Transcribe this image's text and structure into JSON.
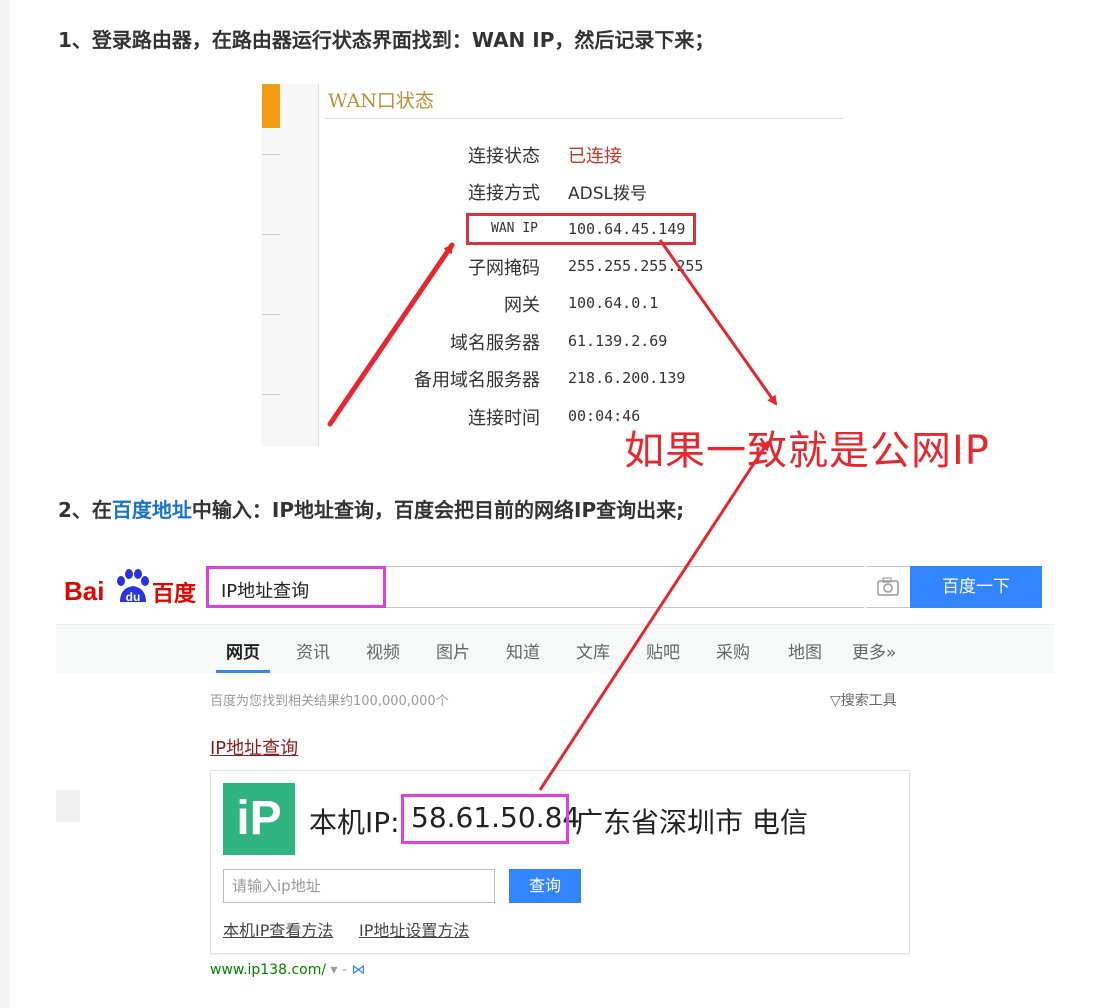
{
  "steps": {
    "step1": "1、登录路由器，在路由器运行状态界面找到：WAN IP，然后记录下来；",
    "step2_prefix": "2、在",
    "step2_link": "百度地址",
    "step2_suffix": "中输入：IP地址查询，百度会把目前的网络IP查询出来;"
  },
  "router": {
    "title": "WAN口状态",
    "rows": [
      {
        "label": "连接状态",
        "value": "已连接"
      },
      {
        "label": "连接方式",
        "value": "ADSL拨号"
      },
      {
        "label": "WAN IP",
        "value": "100.64.45.149"
      },
      {
        "label": "子网掩码",
        "value": "255.255.255.255"
      },
      {
        "label": "网关",
        "value": "100.64.0.1"
      },
      {
        "label": "域名服务器",
        "value": "61.139.2.69"
      },
      {
        "label": "备用域名服务器",
        "value": "218.6.200.139"
      },
      {
        "label": "连接时间",
        "value": "00:04:46"
      }
    ]
  },
  "annotation": "如果一致就是公网IP",
  "baidu": {
    "logo_latin": "Bai",
    "logo_paw_text": "du",
    "logo_cn": "百度",
    "query": "IP地址查询",
    "search_button": "百度一下",
    "tabs": [
      "网页",
      "资讯",
      "视频",
      "图片",
      "知道",
      "文库",
      "贴吧",
      "采购",
      "地图",
      "更多»"
    ],
    "result_count": "百度为您找到相关结果约100,000,000个",
    "search_tools": "▽搜索工具",
    "result_title": "IP地址查询",
    "ip_card": {
      "logo": "iP",
      "label": "本机IP:",
      "ip": "58.61.50.84",
      "location": "广东省深圳市 电信",
      "input_placeholder": "请输入ip地址",
      "query_button": "查询",
      "link1": "本机IP查看方法",
      "link2": "IP地址设置方法"
    },
    "url": "www.ip138.com/",
    "url_suffix": " ▾ - "
  },
  "colors": {
    "annotation_red": "#e8262e",
    "highlight_magenta": "#e040e0",
    "baidu_red": "#e10601",
    "baidu_blue": "#3385ff",
    "link_blue": "#1a73c9",
    "ip_green": "#2fb380"
  }
}
